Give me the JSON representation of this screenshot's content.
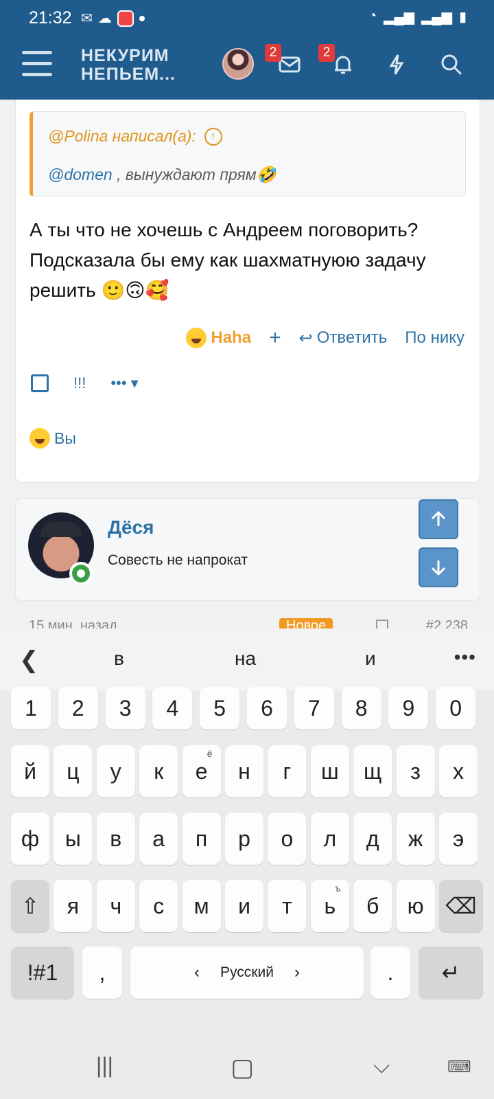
{
  "status_bar": {
    "time": "21:32"
  },
  "header": {
    "logo_line1": "НЕКУРИМ",
    "logo_line2": "НЕПЬЕМ...",
    "inbox_badge": "2",
    "alerts_badge": "2"
  },
  "post": {
    "quote_author": "@Polina написал(а):",
    "quote_mention": "@domen",
    "quote_text": " , вынуждают прям🤣",
    "body": "А ты что не хочешь с Андреем поговорить? Подсказала бы ему как шахматнуюю задачу решить 🙂🙃🥰",
    "reaction_label": "Haha",
    "add_reaction": "+",
    "reply_label": "Ответить",
    "by_nick_label": "По нику",
    "bang_label": "!!!",
    "more_label": "•••",
    "reactors_label": "Вы"
  },
  "next_post": {
    "username": "Дёся",
    "user_title": "Совесть не напрокат",
    "time": "15 мин. назад",
    "new_badge": "Новое",
    "post_number": "#2 238"
  },
  "keyboard": {
    "suggestions": [
      "в",
      "на",
      "и"
    ],
    "row_numbers": [
      "1",
      "2",
      "3",
      "4",
      "5",
      "6",
      "7",
      "8",
      "9",
      "0"
    ],
    "row1": [
      "й",
      "ц",
      "у",
      "к",
      "е",
      "н",
      "г",
      "ш",
      "щ",
      "з",
      "х"
    ],
    "row1_hint_e": "ё",
    "row2": [
      "ф",
      "ы",
      "в",
      "а",
      "п",
      "р",
      "о",
      "л",
      "д",
      "ж",
      "э"
    ],
    "row3": [
      "я",
      "ч",
      "с",
      "м",
      "и",
      "т",
      "ь",
      "б",
      "ю"
    ],
    "row3_hint_soft": "ъ",
    "symbols_key": "!#1",
    "comma_key": ",",
    "language": "Русский",
    "period_key": "."
  }
}
